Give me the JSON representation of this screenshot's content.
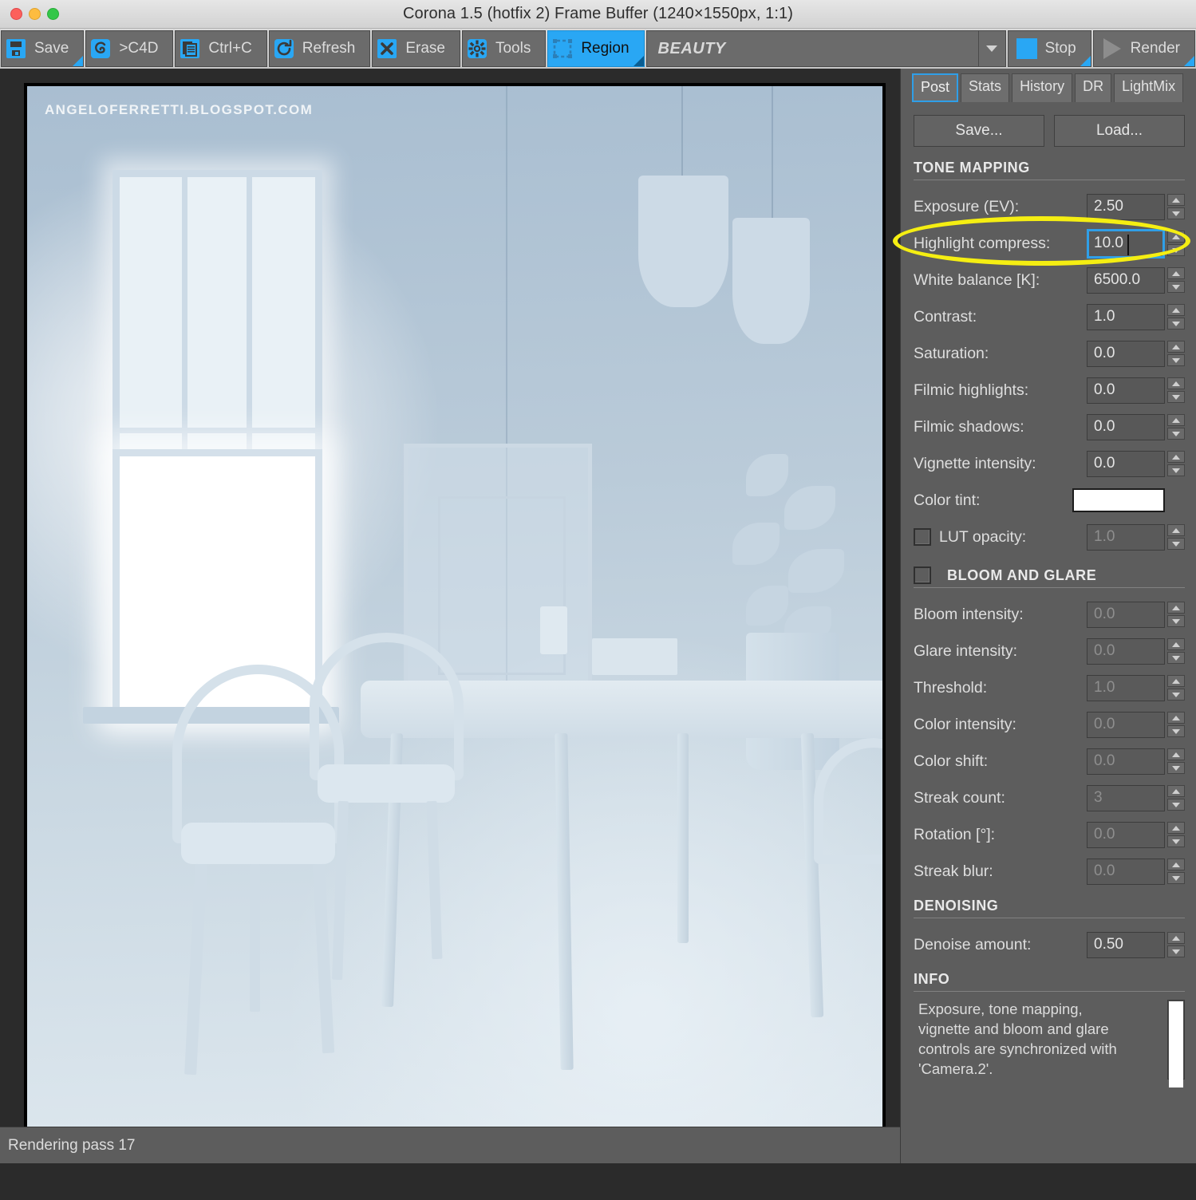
{
  "window": {
    "title": "Corona 1.5 (hotfix 2) Frame Buffer (1240×1550px, 1:1)",
    "traffic_lights": [
      "close",
      "minimize",
      "zoom"
    ]
  },
  "toolbar": {
    "buttons": [
      {
        "label": "Save",
        "icon": "floppy-disk-icon",
        "active": false,
        "has_corner": true
      },
      {
        "label": ">C4D",
        "icon": "cinema4d-icon",
        "active": false,
        "has_corner": false
      },
      {
        "label": "Ctrl+C",
        "icon": "copy-icon",
        "active": false,
        "has_corner": false
      },
      {
        "label": "Refresh",
        "icon": "refresh-icon",
        "active": false,
        "has_corner": false
      },
      {
        "label": "Erase",
        "icon": "x-cross-icon",
        "active": false,
        "has_corner": false
      },
      {
        "label": "Tools",
        "icon": "gear-icon",
        "active": false,
        "has_corner": false
      },
      {
        "label": "Region",
        "icon": "region-select-icon",
        "active": true,
        "has_corner": true
      }
    ],
    "pass_selector": {
      "value": "BEAUTY",
      "icon": "chevron-down-icon"
    },
    "stop": {
      "label": "Stop",
      "icon": "stop-square-icon"
    },
    "render": {
      "label": "Render",
      "icon": "play-triangle-icon"
    },
    "accent_color": "#29a7f4"
  },
  "viewport": {
    "watermark": "ANGELOFERRETTI.BLOGSPOT.COM"
  },
  "panel": {
    "tabs": [
      {
        "label": "Post",
        "selected": true
      },
      {
        "label": "Stats",
        "selected": false
      },
      {
        "label": "History",
        "selected": false
      },
      {
        "label": "DR",
        "selected": false
      },
      {
        "label": "LightMix",
        "selected": false
      }
    ],
    "preset_buttons": {
      "save": "Save...",
      "load": "Load..."
    },
    "tone_mapping": {
      "heading": "TONE MAPPING",
      "rows": [
        {
          "label": "Exposure (EV):",
          "value": "2.50",
          "type": "spinner",
          "disabled": false,
          "focused": false
        },
        {
          "label": "Highlight compress:",
          "value": "10.0",
          "type": "spinner",
          "disabled": false,
          "focused": true
        },
        {
          "label": "White balance [K]:",
          "value": "6500.0",
          "type": "spinner",
          "disabled": false,
          "focused": false
        },
        {
          "label": "Contrast:",
          "value": "1.0",
          "type": "spinner",
          "disabled": false,
          "focused": false
        },
        {
          "label": "Saturation:",
          "value": "0.0",
          "type": "spinner",
          "disabled": false,
          "focused": false
        },
        {
          "label": "Filmic highlights:",
          "value": "0.0",
          "type": "spinner",
          "disabled": false,
          "focused": false
        },
        {
          "label": "Filmic shadows:",
          "value": "0.0",
          "type": "spinner",
          "disabled": false,
          "focused": false
        },
        {
          "label": "Vignette intensity:",
          "value": "0.0",
          "type": "spinner",
          "disabled": false,
          "focused": false
        },
        {
          "label": "Color tint:",
          "value": "#FFFFFF",
          "type": "swatch",
          "disabled": false,
          "focused": false
        },
        {
          "label": "LUT opacity:",
          "value": "1.0",
          "type": "spinner",
          "disabled": true,
          "focused": false,
          "checkbox": false
        }
      ]
    },
    "bloom_and_glare": {
      "heading": "BLOOM AND GLARE",
      "enabled": false,
      "rows": [
        {
          "label": "Bloom intensity:",
          "value": "0.0",
          "disabled": true
        },
        {
          "label": "Glare intensity:",
          "value": "0.0",
          "disabled": true
        },
        {
          "label": "Threshold:",
          "value": "1.0",
          "disabled": true
        },
        {
          "label": "Color intensity:",
          "value": "0.0",
          "disabled": true
        },
        {
          "label": "Color shift:",
          "value": "0.0",
          "disabled": true
        },
        {
          "label": "Streak count:",
          "value": "3",
          "disabled": true
        },
        {
          "label": "Rotation [°]:",
          "value": "0.0",
          "disabled": true
        },
        {
          "label": "Streak blur:",
          "value": "0.0",
          "disabled": true
        }
      ]
    },
    "denoising": {
      "heading": "DENOISING",
      "rows": [
        {
          "label": "Denoise amount:",
          "value": "0.50",
          "disabled": false
        }
      ]
    },
    "info": {
      "heading": "INFO",
      "text": "Exposure, tone mapping,\nvignette and bloom and glare\ncontrols are synchronized with\n'Camera.2'."
    }
  },
  "annotation": {
    "type": "ellipse-highlight",
    "color": "#F5EE12",
    "targets": "Highlight compress:"
  },
  "statusbar": {
    "text": "Rendering pass 17"
  }
}
